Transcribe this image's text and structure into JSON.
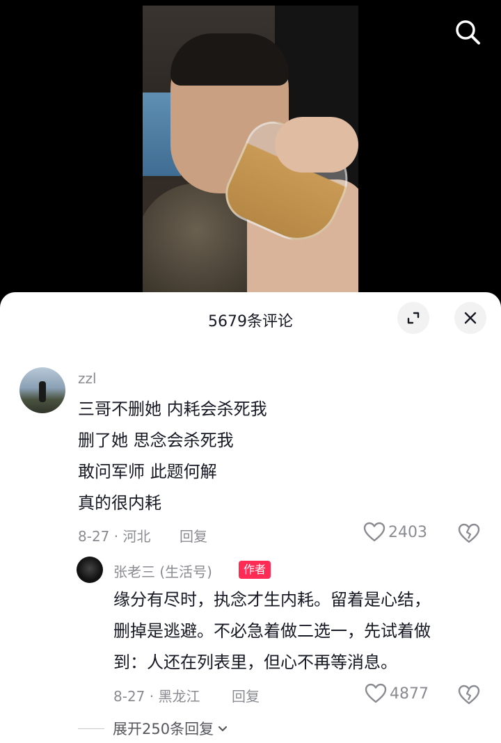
{
  "video": {
    "search_icon": "search-icon"
  },
  "panel": {
    "title": "5679条评论",
    "expand_icon": "expand-icon",
    "close_icon": "close-icon"
  },
  "comment": {
    "username": "zzl",
    "lines": [
      "三哥不删她  内耗会杀死我",
      "删了她  思念会杀死我",
      "敢问军师 此题何解",
      "真的很内耗"
    ],
    "date_location": "8-27 · 河北",
    "reply_label": "回复",
    "likes": "2403"
  },
  "reply": {
    "username": "张老三 (生活号)",
    "tag": "作者",
    "lines": [
      "缘分有尽时，执念才生内耗。留着是心结，",
      "删掉是逃避。不必急着做二选一，先试着做",
      "到：人还在列表里，但心不再等消息。"
    ],
    "date_location": "8-27 · 黑龙江",
    "reply_label": "回复",
    "likes": "4877"
  },
  "expand_replies": "展开250条回复"
}
